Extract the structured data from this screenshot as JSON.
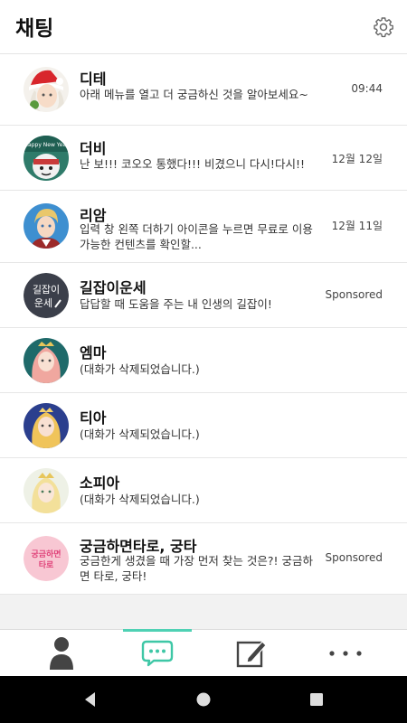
{
  "header": {
    "title": "채팅",
    "settings_icon": "gear-icon"
  },
  "chats": [
    {
      "name": "디테",
      "message": "아래 메뉴를 열고 더 궁금하신 것을 알아보세요~",
      "time": "09:44",
      "avatar": "avatar-dite"
    },
    {
      "name": "더비",
      "message": "난 보!!! 코오오 통했다!!! 비겼으니 다시!다시!!",
      "time": "12월 12일",
      "avatar": "avatar-derby"
    },
    {
      "name": "리암",
      "message": "입력 창 왼쪽 더하기 아이콘을 누르면 무료로 이용 가능한 컨텐츠를 확인할...",
      "time": "12월 11일",
      "avatar": "avatar-liam"
    },
    {
      "name": "길잡이운세",
      "message": "답답할 때 도움을 주는 내 인생의 길잡이!",
      "time": "Sponsored",
      "avatar": "avatar-gil",
      "avatar_text": [
        "길잡이",
        "운세"
      ]
    },
    {
      "name": "엠마",
      "message": "(대화가 삭제되었습니다.)",
      "time": "",
      "avatar": "avatar-emma"
    },
    {
      "name": "티아",
      "message": "(대화가 삭제되었습니다.)",
      "time": "",
      "avatar": "avatar-tia"
    },
    {
      "name": "소피아",
      "message": "(대화가 삭제되었습니다.)",
      "time": "",
      "avatar": "avatar-sophia"
    },
    {
      "name": "궁금하면타로, 궁타",
      "message": "궁금한게 생겼을 때 가장 먼저 찾는 것은?! 궁금하면 타로, 궁타!",
      "time": "Sponsored",
      "avatar": "avatar-gungta",
      "avatar_text": [
        "궁금하면",
        "타로"
      ]
    }
  ],
  "tabs": [
    {
      "name": "profile",
      "icon": "person-icon",
      "active": false
    },
    {
      "name": "chats",
      "icon": "chat-bubble-icon",
      "active": true
    },
    {
      "name": "write",
      "icon": "edit-icon",
      "active": false
    },
    {
      "name": "more",
      "icon": "more-icon",
      "active": false
    }
  ],
  "colors": {
    "accent": "#4fd1b4",
    "divider": "#e6e6e6",
    "navbar": "#000000"
  }
}
